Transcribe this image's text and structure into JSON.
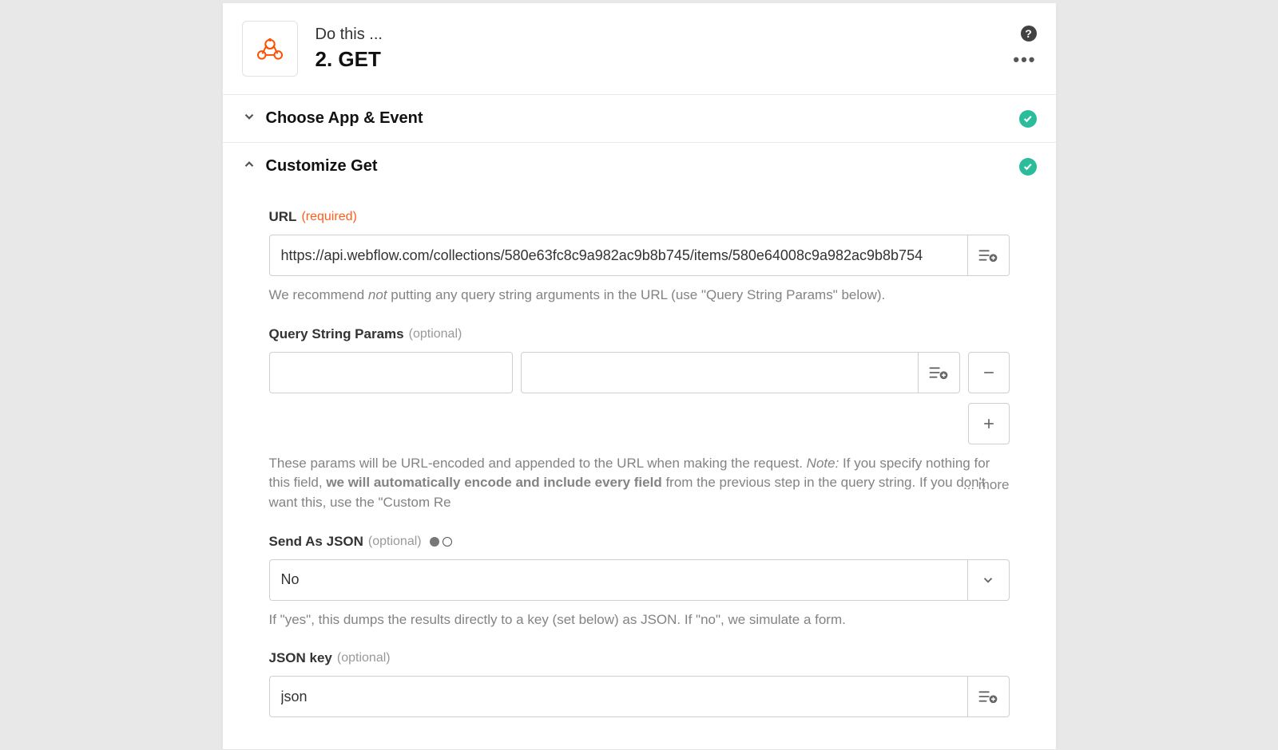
{
  "header": {
    "eyebrow": "Do this ...",
    "title": "2. GET"
  },
  "sections": {
    "choose": {
      "title": "Choose App & Event"
    },
    "customize": {
      "title": "Customize Get"
    }
  },
  "fields": {
    "url": {
      "label": "URL",
      "required_text": "(required)",
      "value": "https://api.webflow.com/collections/580e63fc8c9a982ac9b8b745/items/580e64008c9a982ac9b8b754",
      "helper_pre": "We recommend ",
      "helper_em": "not",
      "helper_post": " putting any query string arguments in the URL (use \"Query String Params\" below)."
    },
    "qsp": {
      "label": "Query String Params",
      "optional_text": "(optional)",
      "helper_p1_a": "These params will be URL-encoded and appended to the URL when making the request. ",
      "helper_p1_note": "Note:",
      "helper_p1_b": " If you specify nothing for this field, ",
      "helper_p1_strong": "we will automatically encode and include every field",
      "helper_p1_c": " from the previous step in the query string. If you don't want this, use the \"Custom Re",
      "more": "...  more"
    },
    "send_json": {
      "label": "Send As JSON",
      "optional_text": "(optional)",
      "value": "No",
      "helper": "If \"yes\", this dumps the results directly to a key (set below) as JSON. If \"no\", we simulate a form."
    },
    "json_key": {
      "label": "JSON key",
      "optional_text": "(optional)",
      "value": "json"
    }
  }
}
